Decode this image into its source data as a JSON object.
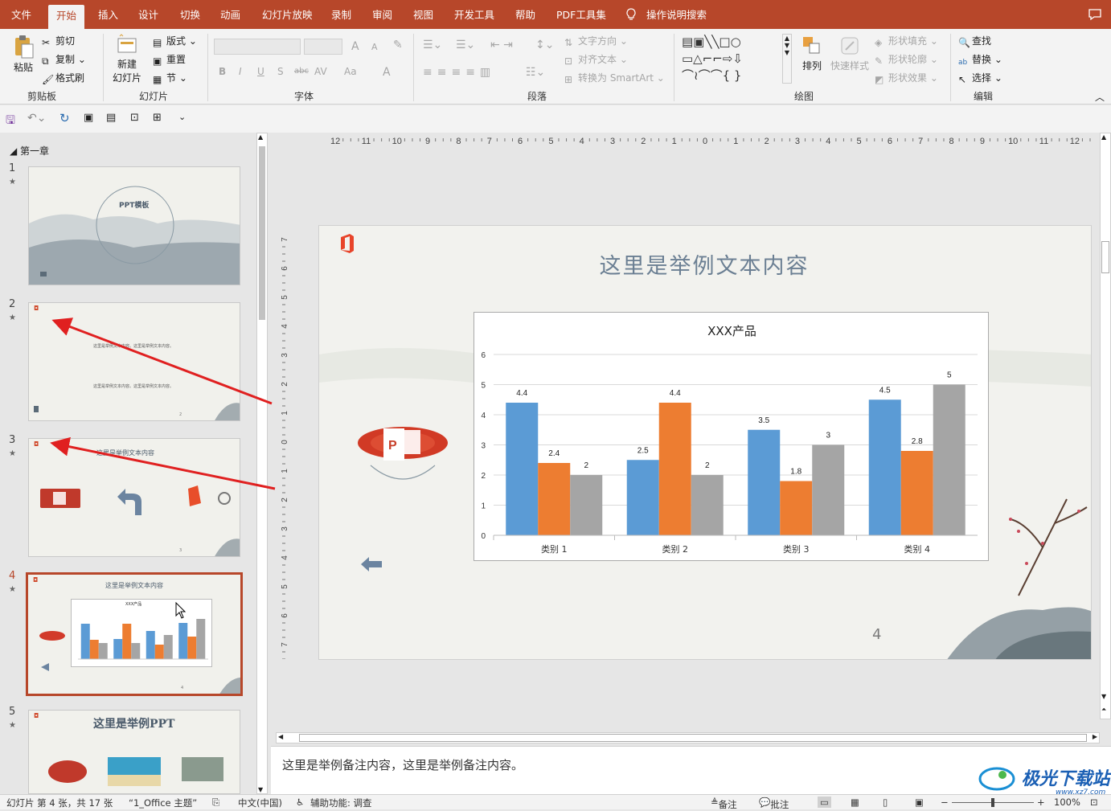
{
  "tabs": [
    "文件",
    "开始",
    "插入",
    "设计",
    "切换",
    "动画",
    "幻灯片放映",
    "录制",
    "审阅",
    "视图",
    "开发工具",
    "帮助",
    "PDF工具集",
    "操作说明搜索"
  ],
  "active_tab": "开始",
  "ribbon": {
    "clipboard": {
      "paste": "粘贴",
      "cut": "剪切",
      "copy": "复制",
      "format_painter": "格式刷",
      "label": "剪贴板"
    },
    "slides": {
      "new_slide_1": "新建",
      "new_slide_2": "幻灯片",
      "layout": "版式",
      "reset": "重置",
      "section": "节",
      "label": "幻灯片"
    },
    "font": {
      "label": "字体",
      "bold": "B",
      "italic": "I",
      "underline": "U",
      "shadow": "S",
      "strike": "abc",
      "spacing": "AV",
      "case": "Aa",
      "color": "A",
      "grow": "A",
      "shrink": "A"
    },
    "paragraph": {
      "label": "段落",
      "text_direction": "文字方向",
      "align_text": "对齐文本",
      "smartart": "转换为 SmartArt"
    },
    "drawing": {
      "label": "绘图",
      "arrange": "排列",
      "quick_styles": "快速样式",
      "shape_fill": "形状填充",
      "shape_outline": "形状轮廓",
      "shape_effects": "形状效果"
    },
    "editing": {
      "label": "编辑",
      "find": "查找",
      "replace": "替换",
      "select": "选择"
    }
  },
  "section_title": "第一章",
  "thumbnails": [
    {
      "num": "1",
      "title": "PPT模板"
    },
    {
      "num": "2",
      "line1": "这里是举例文本内容。这里是举例文本内容。",
      "line2": "这里是举例文本内容。这里是举例文本内容。",
      "page": "2"
    },
    {
      "num": "3",
      "title": "这里是举例文本内容",
      "page": "3"
    },
    {
      "num": "4",
      "title": "这里是举例文本内容",
      "chart": "XXX产品",
      "page": "4"
    },
    {
      "num": "5",
      "title": "这里是举例PPT"
    }
  ],
  "ruler_h": [
    "12",
    "11",
    "10",
    "9",
    "8",
    "7",
    "6",
    "5",
    "4",
    "3",
    "2",
    "1",
    "0",
    "1",
    "2",
    "3",
    "4",
    "5",
    "6",
    "7",
    "8",
    "9",
    "10",
    "11",
    "12"
  ],
  "ruler_v": [
    "7",
    "6",
    "5",
    "4",
    "3",
    "2",
    "1",
    "0",
    "1",
    "2",
    "3",
    "4",
    "5",
    "6",
    "7"
  ],
  "slide": {
    "title": "这里是举例文本内容",
    "page_number": "4"
  },
  "chart_data": {
    "type": "bar",
    "title": "XXX产品",
    "categories": [
      "类别 1",
      "类别 2",
      "类别 3",
      "类别 4"
    ],
    "series": [
      {
        "values": [
          4.4,
          2.5,
          3.5,
          4.5
        ],
        "color": "#5b9bd5"
      },
      {
        "values": [
          2.4,
          4.4,
          1.8,
          2.8
        ],
        "color": "#ed7d31"
      },
      {
        "values": [
          2,
          2,
          3,
          5
        ],
        "color": "#a5a5a5"
      }
    ],
    "ylim": [
      0,
      6
    ],
    "yticks": [
      "0",
      "1",
      "2",
      "3",
      "4",
      "5",
      "6"
    ],
    "grid": true
  },
  "notes": "这里是举例备注内容，这里是举例备注内容。",
  "status": {
    "slide_info": "幻灯片 第 4 张，共 17 张",
    "theme": "“1_Office 主题”",
    "language": "中文(中国)",
    "accessibility": "辅助功能: 调查",
    "notes_btn": "备注",
    "comments_btn": "批注",
    "zoom": "100%"
  },
  "watermark": "极光下载站",
  "watermark_url": "www.xz7.com",
  "colors": {
    "accent": "#b7472a",
    "chart_blue": "#5b9bd5",
    "chart_orange": "#ed7d31",
    "chart_gray": "#a5a5a5",
    "arrow": "#e02020"
  }
}
